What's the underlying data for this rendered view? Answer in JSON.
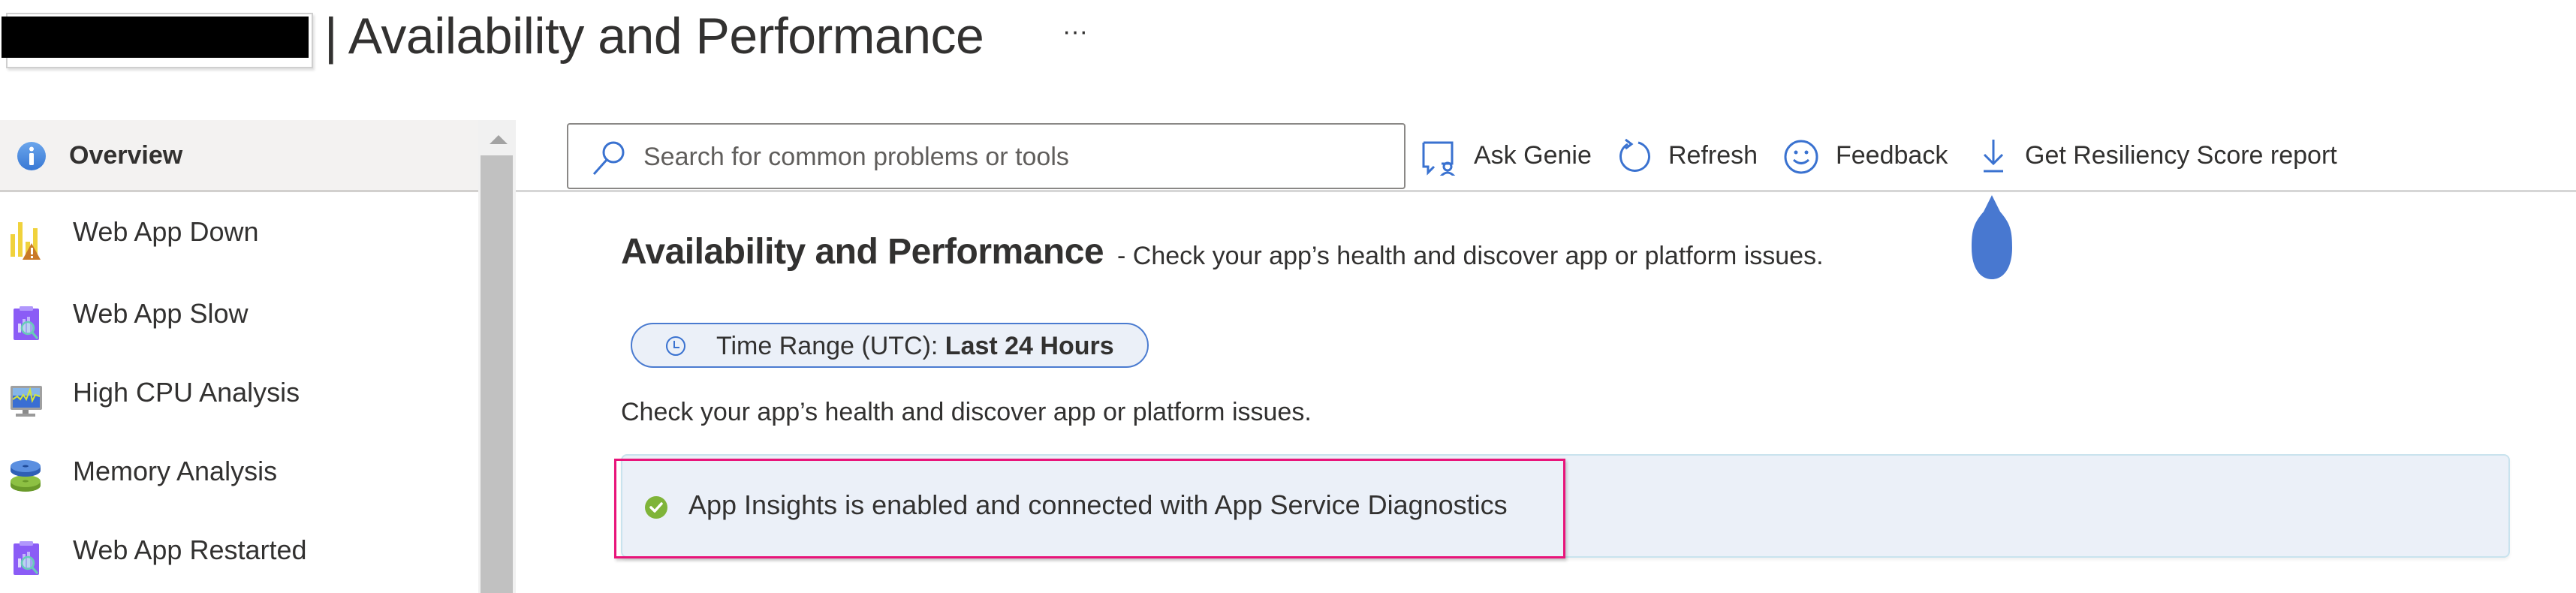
{
  "window": {
    "title": "| Availability and Performance",
    "more_label": "···",
    "resource_name_redacted": true
  },
  "sidebar": {
    "items": [
      {
        "label": "Overview",
        "icon": "info-icon",
        "selected": true
      },
      {
        "label": "Web App Down",
        "icon": "bar-chart-warning-icon"
      },
      {
        "label": "Web App Slow",
        "icon": "clipboard-search-icon"
      },
      {
        "label": "High CPU Analysis",
        "icon": "monitor-cpu-icon"
      },
      {
        "label": "Memory Analysis",
        "icon": "memory-disk-icon"
      },
      {
        "label": "Web App Restarted",
        "icon": "clipboard-search-icon"
      }
    ]
  },
  "toolbar": {
    "search": {
      "placeholder": "Search for common problems or tools",
      "value": ""
    },
    "buttons": [
      {
        "label": "Ask Genie",
        "icon": "ask-genie-icon"
      },
      {
        "label": "Refresh",
        "icon": "refresh-icon"
      },
      {
        "label": "Feedback",
        "icon": "smiley-icon"
      },
      {
        "label": "Get Resiliency Score report",
        "icon": "download-icon"
      }
    ]
  },
  "main": {
    "title": "Availability and Performance",
    "subtitle": "- Check your app’s health and discover app or platform issues.",
    "time_range": {
      "prefix": "Time Range (UTC):",
      "value": "Last 24 Hours"
    },
    "description": "Check your app’s health and discover app or platform issues.",
    "banner": {
      "text": "App Insights is enabled and connected with App Service Diagnostics",
      "status": "success"
    }
  },
  "colors": {
    "accent": "#4a7bd0",
    "success": "#7fb439",
    "highlight": "#e8147a",
    "banner_bg": "#ebf0f8"
  }
}
